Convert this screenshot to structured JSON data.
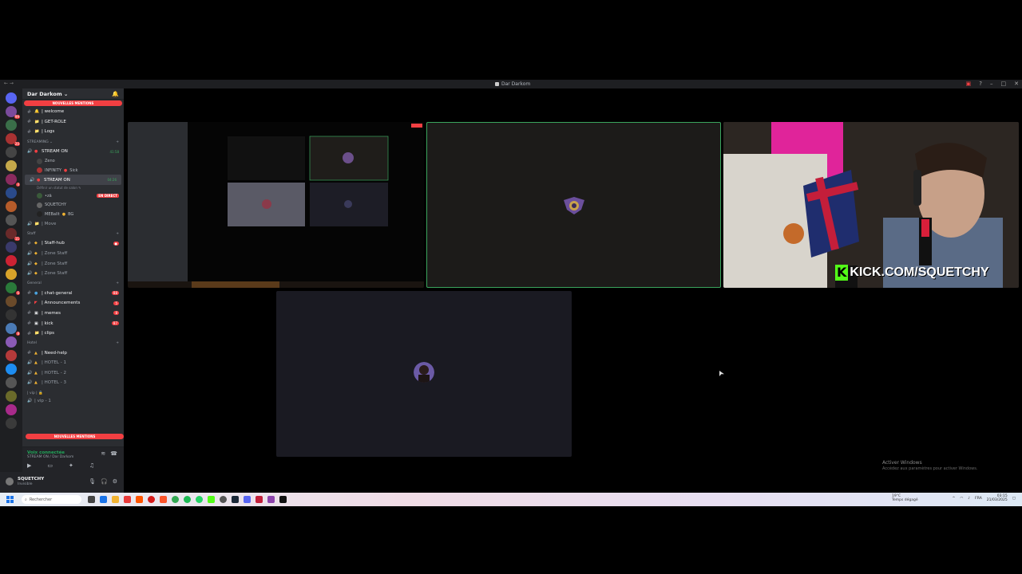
{
  "window": {
    "title": "Dar Darkom",
    "nav": "← →"
  },
  "server": {
    "name": "Dar Darkom ⌄"
  },
  "mentions_pill": "NOUVELLES MENTIONS",
  "channels_top": [
    {
      "icon": "#",
      "emoji": "🔔",
      "label": "| welcome"
    },
    {
      "icon": "#",
      "emoji": "📁",
      "label": "| GET-ROLE"
    },
    {
      "icon": "#",
      "emoji": "📁",
      "label": "| Logs"
    }
  ],
  "category_streaming": "STREAMING ⌄",
  "streaming": {
    "channel1": {
      "label": "STREAM ON",
      "time": "41:58"
    },
    "channel1_users": [
      "Zeno",
      "INFINITY"
    ],
    "channel1_user2_tag": "Sick",
    "channel2": {
      "label": "STREAM ON",
      "time": "04:26"
    },
    "channel2_sub": "Définir un statut de salon ✎",
    "channel2_users": [
      "•zä",
      "SQUETCHY",
      "MEBallt"
    ],
    "channel2_live": "EN DIRECT",
    "channel2_user3_tag": "BG"
  },
  "channel_move": "| Move",
  "category_staff": "Staff",
  "staff": [
    {
      "label": "| Staff-hub"
    },
    {
      "label": "| Zone Staff"
    },
    {
      "label": "| Zone Staff"
    },
    {
      "label": "| Zone Staff"
    }
  ],
  "category_general": "General",
  "general": [
    {
      "label": "| chat-general",
      "badge": "88"
    },
    {
      "label": "| Announcements",
      "badge": "5"
    },
    {
      "label": "| memes",
      "badge": "8"
    },
    {
      "label": "| kick",
      "badge": "87"
    },
    {
      "label": "| clips",
      "badge": ""
    }
  ],
  "category_hotel": "Hotel",
  "hotel": [
    {
      "label": "| Need-help"
    },
    {
      "label": "| HOTEL - 1"
    },
    {
      "label": "| HOTEL - 2"
    },
    {
      "label": "| HOTEL - 3"
    }
  ],
  "category_vip": "| vip | 🔒",
  "vip_item": "| vip - 1",
  "voice": {
    "connected": "Voix connectée",
    "location": "STREAM ON / Dar Darkom"
  },
  "user": {
    "name": "SQUETCHY",
    "status": "Invisible"
  },
  "stream_overlay_text": "KICK.COM/SQUETCHY",
  "taskbar": {
    "search_placeholder": "Rechercher",
    "weather_temp": "19°C",
    "weather_desc": "Temps dégagé",
    "lang": "FRA",
    "time": "03:15",
    "date": "21/03/2025"
  },
  "watermark": {
    "title": "Activer Windows",
    "subtitle": "Accédez aux paramètres pour activer Windows."
  },
  "colors": {
    "accent_red": "#f23f42",
    "speaking_green": "#3ba55d",
    "discord_blurple": "#5865f2"
  }
}
